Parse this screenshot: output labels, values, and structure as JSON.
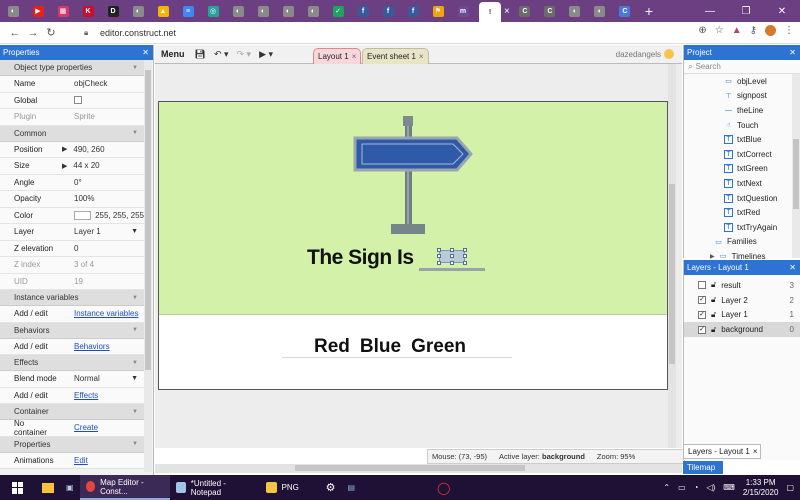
{
  "browser": {
    "url": "editor.construct.net",
    "tabs": [
      {
        "icon": "circle-icon",
        "color": "#8a8a8a",
        "glyph": "◐"
      },
      {
        "icon": "youtube-icon",
        "color": "#e62117",
        "glyph": "▶"
      },
      {
        "icon": "grid-icon",
        "color": "#d23a6f",
        "glyph": "▦"
      },
      {
        "icon": "k-icon",
        "color": "#c8102e",
        "glyph": "K"
      },
      {
        "icon": "d-icon",
        "color": "#222222",
        "glyph": "D"
      },
      {
        "icon": "circle-icon",
        "color": "#8a8a8a",
        "glyph": "◐"
      },
      {
        "icon": "drive-icon",
        "color": "#f4b400",
        "glyph": "▲"
      },
      {
        "icon": "doc-icon",
        "color": "#4285f4",
        "glyph": "≡"
      },
      {
        "icon": "ring-icon",
        "color": "#2aa198",
        "glyph": "◎"
      },
      {
        "icon": "circle-icon",
        "color": "#8a8a8a",
        "glyph": "◐"
      },
      {
        "icon": "circle-icon",
        "color": "#8a8a8a",
        "glyph": "◐"
      },
      {
        "icon": "circle-icon",
        "color": "#8a8a8a",
        "glyph": "◐"
      },
      {
        "icon": "circle-icon",
        "color": "#8a8a8a",
        "glyph": "◐"
      },
      {
        "icon": "shield-check-icon",
        "color": "#1da462",
        "glyph": "✓"
      },
      {
        "icon": "facebook-icon",
        "color": "#3b5998",
        "glyph": "f"
      },
      {
        "icon": "facebook-icon",
        "color": "#3b5998",
        "glyph": "f"
      },
      {
        "icon": "facebook-icon",
        "color": "#3b5998",
        "glyph": "f"
      },
      {
        "icon": "flag-icon",
        "color": "#f0a30a",
        "glyph": "⚑"
      },
      {
        "icon": "m-icon",
        "color": "#6a4c93",
        "glyph": "m"
      }
    ],
    "tabs_after": [
      {
        "icon": "c-icon",
        "color": "#6b6b6b",
        "glyph": "C"
      },
      {
        "icon": "c-icon",
        "color": "#6b6b6b",
        "glyph": "C"
      },
      {
        "icon": "circle-icon",
        "color": "#8a8a8a",
        "glyph": "◐"
      },
      {
        "icon": "circle-icon",
        "color": "#8a8a8a",
        "glyph": "◐"
      },
      {
        "icon": "c-icon",
        "color": "#4a7ad8",
        "glyph": "C"
      }
    ],
    "active_tab_glyph": "!",
    "active_tab_close": "×"
  },
  "properties": {
    "title": "Properties",
    "rows": [
      {
        "type": "section",
        "label": "Object type properties"
      },
      {
        "type": "row",
        "key": "Name",
        "value": "objCheck"
      },
      {
        "type": "row",
        "key": "Global",
        "value": "",
        "checkbox": true
      },
      {
        "type": "row",
        "key": "Plugin",
        "value": "Sprite",
        "dim": true
      },
      {
        "type": "section",
        "label": "Common"
      },
      {
        "type": "row",
        "key": "Position",
        "value": "490, 260",
        "arrow": true
      },
      {
        "type": "row",
        "key": "Size",
        "value": "44 x 20",
        "arrow": true
      },
      {
        "type": "row",
        "key": "Angle",
        "value": "0°"
      },
      {
        "type": "row",
        "key": "Opacity",
        "value": "100%"
      },
      {
        "type": "row",
        "key": "Color",
        "value": "255, 255, 255",
        "swatch": true
      },
      {
        "type": "row",
        "key": "Layer",
        "value": "Layer 1",
        "dropdown": true
      },
      {
        "type": "row",
        "key": "Z elevation",
        "value": "0"
      },
      {
        "type": "row",
        "key": "Z index",
        "value": "3 of 4",
        "dim": true
      },
      {
        "type": "row",
        "key": "UID",
        "value": "19",
        "dim": true
      },
      {
        "type": "section",
        "label": "Instance variables"
      },
      {
        "type": "row",
        "key": "Add / edit",
        "value": "Instance variables",
        "link": true
      },
      {
        "type": "section",
        "label": "Behaviors"
      },
      {
        "type": "row",
        "key": "Add / edit",
        "value": "Behaviors",
        "link": true
      },
      {
        "type": "section",
        "label": "Effects"
      },
      {
        "type": "row",
        "key": "Blend mode",
        "value": "Normal",
        "dropdown": true
      },
      {
        "type": "row",
        "key": "Add / edit",
        "value": "Effects",
        "link": true
      },
      {
        "type": "section",
        "label": "Container"
      },
      {
        "type": "row",
        "key": "No container",
        "value": "Create",
        "link": true
      },
      {
        "type": "section",
        "label": "Properties"
      },
      {
        "type": "row",
        "key": "Animations",
        "value": "Edit",
        "link": true
      }
    ]
  },
  "toolbar": {
    "menu": "Menu",
    "tab_layout": "Layout 1",
    "tab_events": "Event sheet 1",
    "user": "dazedangels"
  },
  "layout": {
    "sign_text": "The Sign Is",
    "choices": [
      "Red",
      "Blue",
      "Green"
    ],
    "colors": {
      "top_bg": "#d3f1a9",
      "sign_blue": "#2f5aa8",
      "post": "#6f7d82"
    }
  },
  "status": {
    "mouse": "Mouse: (73, -95)",
    "active_layer_label": "Active layer:",
    "active_layer": "background",
    "zoom": "Zoom: 95%"
  },
  "project": {
    "title": "Project",
    "search_placeholder": "Search",
    "items": [
      {
        "label": "objLevel",
        "icon": "sprite-icon",
        "glyph": "▭"
      },
      {
        "label": "signpost",
        "icon": "signpost-icon",
        "glyph": "⊤"
      },
      {
        "label": "theLine",
        "icon": "line-icon",
        "glyph": "—"
      },
      {
        "label": "Touch",
        "icon": "touch-icon",
        "glyph": "☝"
      },
      {
        "label": "txtBlue",
        "icon": "text-icon",
        "glyph": "T"
      },
      {
        "label": "txtCorrect",
        "icon": "text-icon",
        "glyph": "T"
      },
      {
        "label": "txtGreen",
        "icon": "text-icon",
        "glyph": "T"
      },
      {
        "label": "txtNext",
        "icon": "text-icon",
        "glyph": "T"
      },
      {
        "label": "txtQuestion",
        "icon": "text-icon",
        "glyph": "T"
      },
      {
        "label": "txtRed",
        "icon": "text-icon",
        "glyph": "T"
      },
      {
        "label": "txtTryAgain",
        "icon": "text-icon",
        "glyph": "T"
      },
      {
        "label": "Families",
        "icon": "folder-icon",
        "glyph": "▭",
        "lvl1": true
      },
      {
        "label": "Timelines",
        "icon": "folder-icon",
        "glyph": "▭",
        "lvl1": true
      }
    ]
  },
  "layers": {
    "title": "Layers - Layout 1",
    "rows": [
      {
        "name": "result",
        "num": "3",
        "checked": false
      },
      {
        "name": "Layer 2",
        "num": "2",
        "checked": true
      },
      {
        "name": "Layer 1",
        "num": "1",
        "checked": true
      },
      {
        "name": "background",
        "num": "0",
        "checked": true,
        "selected": true
      }
    ],
    "tab_label": "Layers - Layout 1",
    "tilemap_label": "Tilemap"
  },
  "taskbar": {
    "items": [
      {
        "label": "Map Editor - Const...",
        "icon": "chrome-icon",
        "active": true
      },
      {
        "label": "*Untitled - Notepad",
        "icon": "notepad-icon",
        "active": false
      },
      {
        "label": "PNG",
        "icon": "folder-icon",
        "active": false
      }
    ],
    "time": "1:33 PM",
    "date": "2/15/2020"
  }
}
